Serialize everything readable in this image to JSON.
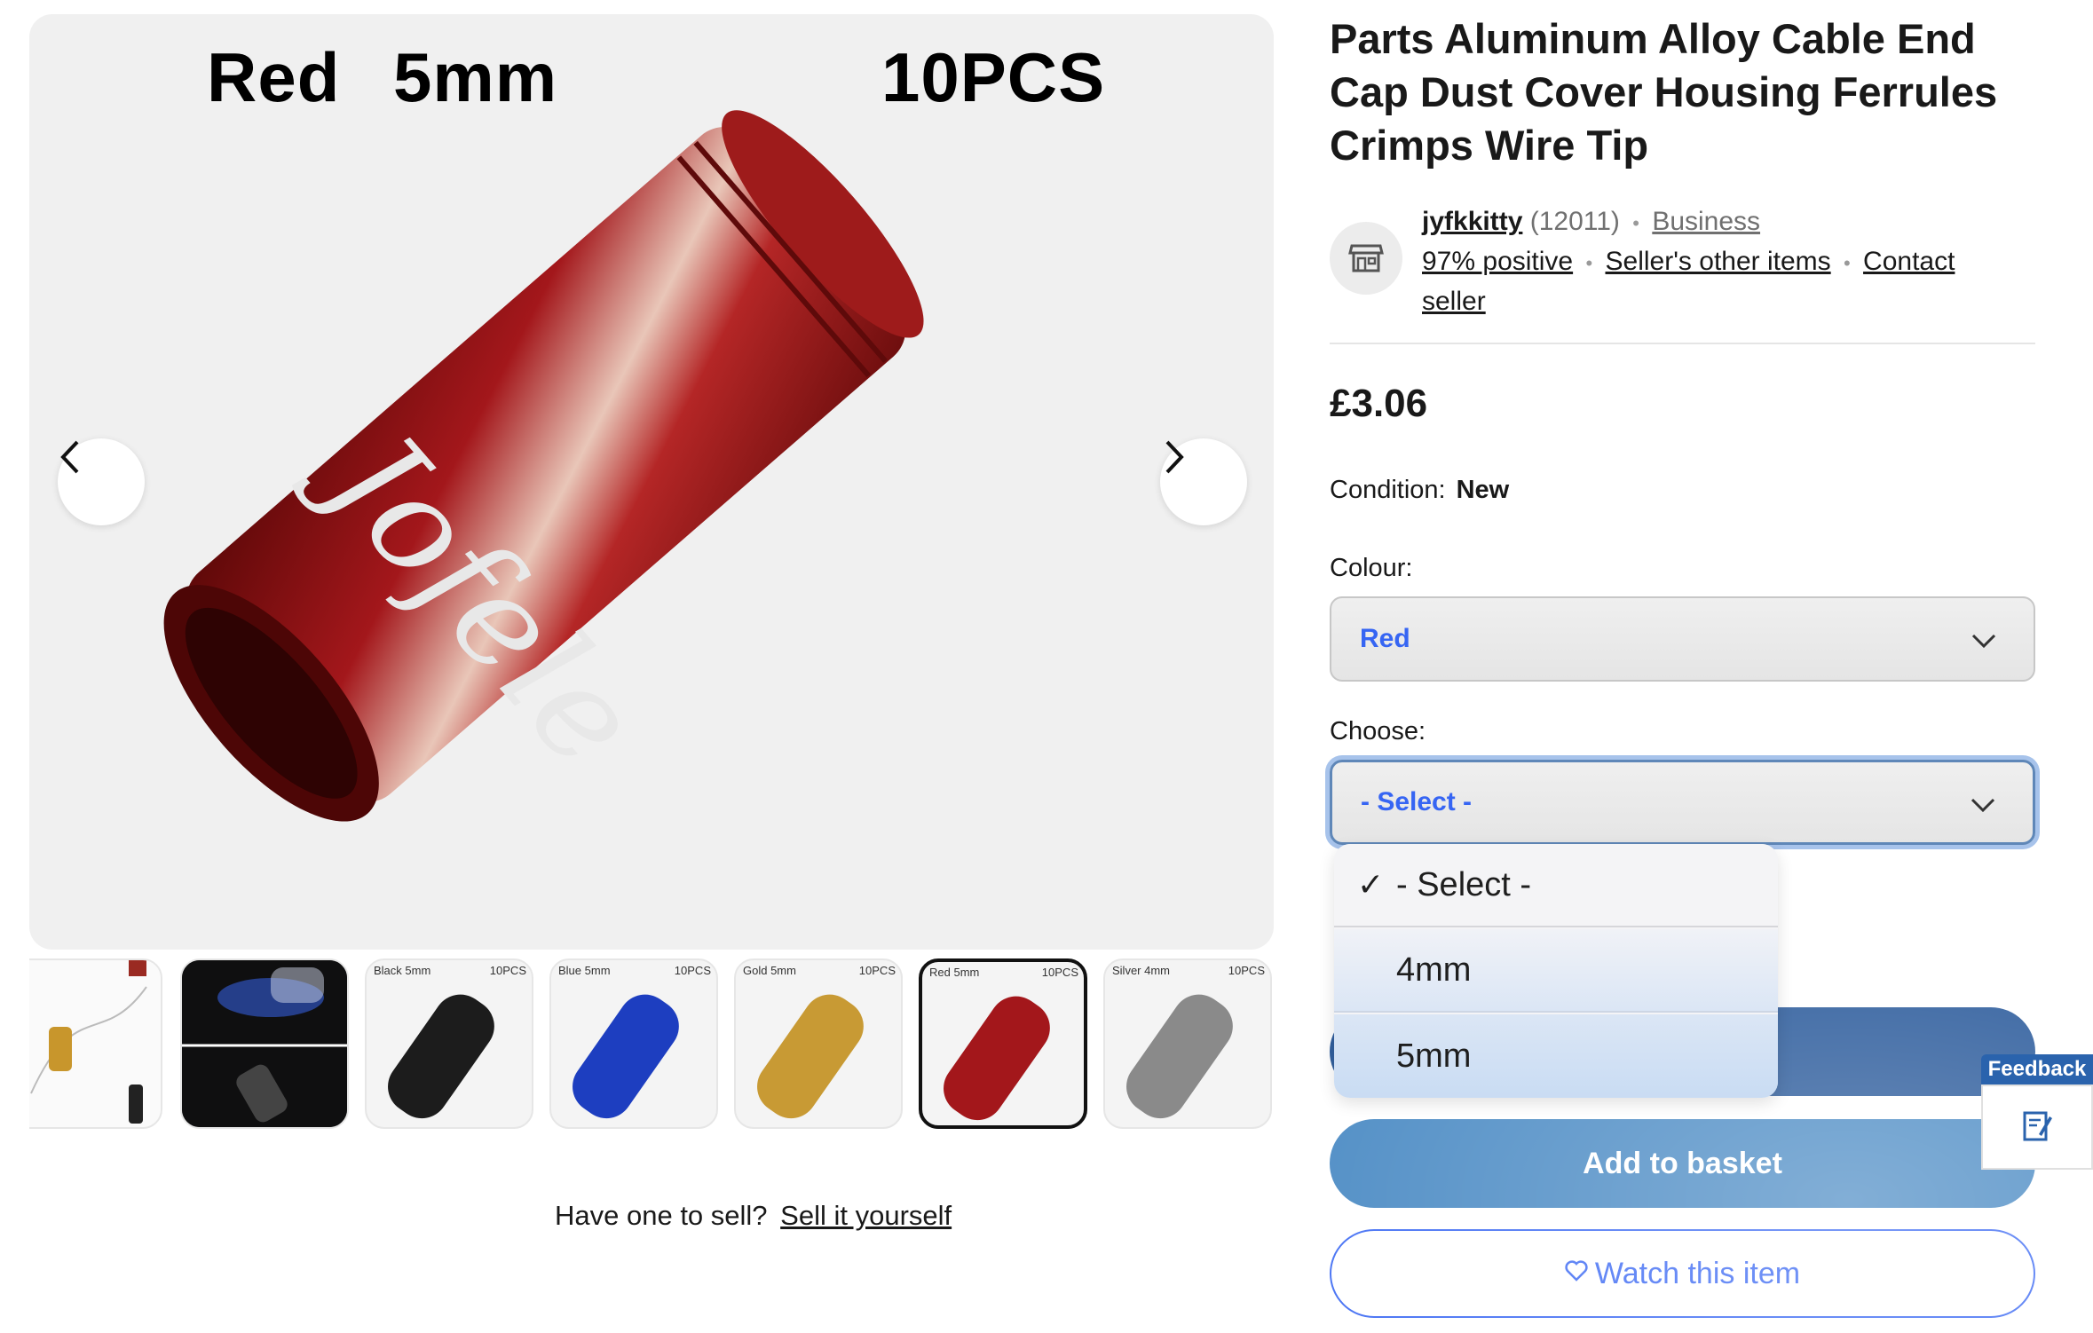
{
  "gallery": {
    "main_image": {
      "color_text": "Red",
      "size_text": "5mm",
      "count_text": "10PCS",
      "alt": "red aluminum cable end cap",
      "accent_color": "#8e1a1a"
    },
    "prev_icon": "chevron-left-icon",
    "next_icon": "chevron-right-icon",
    "thumbnails": [
      {
        "label": "",
        "count": "",
        "color": "#9a2a22"
      },
      {
        "label": "",
        "count": "",
        "color": "#1a3a8a"
      },
      {
        "label": "Black 5mm",
        "count": "10PCS",
        "color": "#1c1c1c"
      },
      {
        "label": "Blue 5mm",
        "count": "10PCS",
        "color": "#1d3ec0"
      },
      {
        "label": "Gold 5mm",
        "count": "10PCS",
        "color": "#c89a34"
      },
      {
        "label": "Red 5mm",
        "count": "10PCS",
        "color": "#a3171b"
      },
      {
        "label": "Silver 4mm",
        "count": "10PCS",
        "color": "#8a8a8a"
      }
    ],
    "sell_prompt": "Have one to sell?",
    "sell_link": "Sell it yourself"
  },
  "listing": {
    "title": "Parts Aluminum Alloy Cable End Cap Dust Cover Housing Ferrules Crimps Wire Tip",
    "seller": {
      "name": "jyfkkitty",
      "feedback_count": "(12011)",
      "type": "Business",
      "positive": "97% positive",
      "other_items": "Seller's other items",
      "contact_part1": "Contact",
      "contact_part2": "seller",
      "avatar_icon": "store-icon"
    },
    "price": "£3.06",
    "condition_label": "Condition:",
    "condition_value": "New"
  },
  "variations": {
    "colour_label": "Colour:",
    "colour_value": "Red",
    "choose_label": "Choose:",
    "choose_value": "- Select -",
    "dropdown_options": [
      {
        "label": "- Select -",
        "checked": true
      },
      {
        "label": "4mm",
        "checked": false
      },
      {
        "label": "5mm",
        "checked": false
      }
    ]
  },
  "actions": {
    "add_to_basket": "Add to basket",
    "watch": "Watch this item",
    "watch_icon": "heart-icon"
  },
  "feedback_tab": {
    "label": "Feedback",
    "icon": "feedback-edit-icon"
  },
  "colors": {
    "link_blue": "#3665f3",
    "buy_button": "#1c4f94",
    "basket_button": "#3f83c0"
  }
}
